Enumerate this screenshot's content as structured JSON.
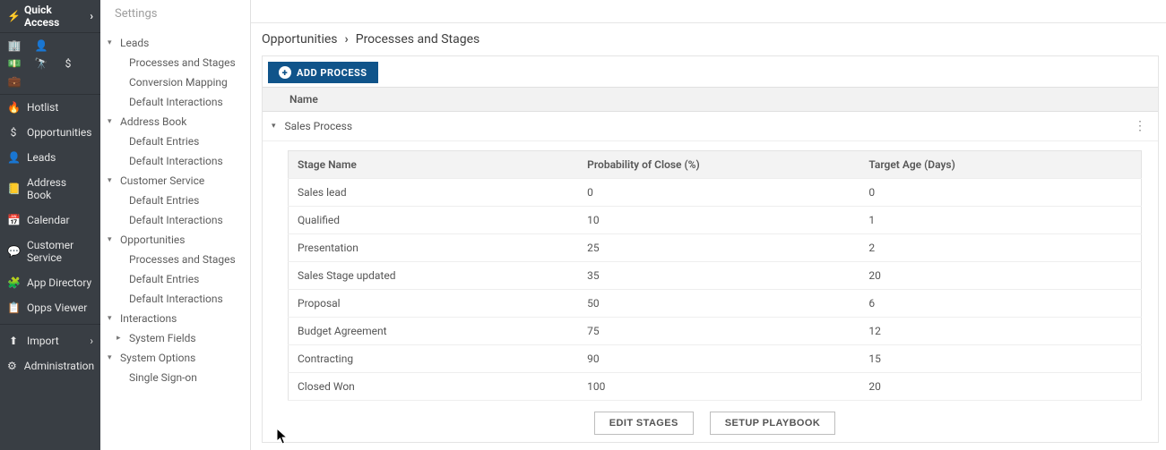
{
  "rail": {
    "quick_access": "Quick Access",
    "items": [
      {
        "icon": "🔥",
        "label": "Hotlist"
      },
      {
        "icon": "$",
        "label": "Opportunities"
      },
      {
        "icon": "👤",
        "label": "Leads"
      },
      {
        "icon": "📒",
        "label": "Address Book"
      },
      {
        "icon": "📅",
        "label": "Calendar"
      },
      {
        "icon": "💬",
        "label": "Customer Service"
      },
      {
        "icon": "🧩",
        "label": "App Directory"
      },
      {
        "icon": "📋",
        "label": "Opps Viewer"
      }
    ],
    "import": "Import",
    "administration": "Administration"
  },
  "settings_title": "Settings",
  "tree": {
    "leads": {
      "label": "Leads",
      "children": [
        "Processes and Stages",
        "Conversion Mapping",
        "Default Interactions"
      ]
    },
    "address_book": {
      "label": "Address Book",
      "children": [
        "Default Entries",
        "Default Interactions"
      ]
    },
    "customer_service": {
      "label": "Customer Service",
      "children": [
        "Default Entries",
        "Default Interactions"
      ]
    },
    "opportunities": {
      "label": "Opportunities",
      "children": [
        "Processes and Stages",
        "Default Entries",
        "Default Interactions"
      ]
    },
    "interactions": {
      "label": "Interactions",
      "children": [
        "System Fields"
      ]
    },
    "system_options": {
      "label": "System Options",
      "children": [
        "Single Sign-on"
      ]
    }
  },
  "breadcrumb": {
    "a": "Opportunities",
    "b": "Processes and Stages"
  },
  "add_process_label": "ADD PROCESS",
  "table": {
    "name_header": "Name",
    "process_name": "Sales Process",
    "stage_headers": {
      "name": "Stage Name",
      "prob": "Probability of Close (%)",
      "age": "Target Age (Days)"
    },
    "stages": [
      {
        "name": "Sales lead",
        "prob": "0",
        "age": "0"
      },
      {
        "name": "Qualified",
        "prob": "10",
        "age": "1"
      },
      {
        "name": "Presentation",
        "prob": "25",
        "age": "2"
      },
      {
        "name": "Sales Stage updated",
        "prob": "35",
        "age": "20"
      },
      {
        "name": "Proposal",
        "prob": "50",
        "age": "6"
      },
      {
        "name": "Budget Agreement",
        "prob": "75",
        "age": "12"
      },
      {
        "name": "Contracting",
        "prob": "90",
        "age": "15"
      },
      {
        "name": "Closed Won",
        "prob": "100",
        "age": "20"
      }
    ]
  },
  "buttons": {
    "edit_stages": "EDIT STAGES",
    "setup_playbook": "SETUP PLAYBOOK"
  }
}
